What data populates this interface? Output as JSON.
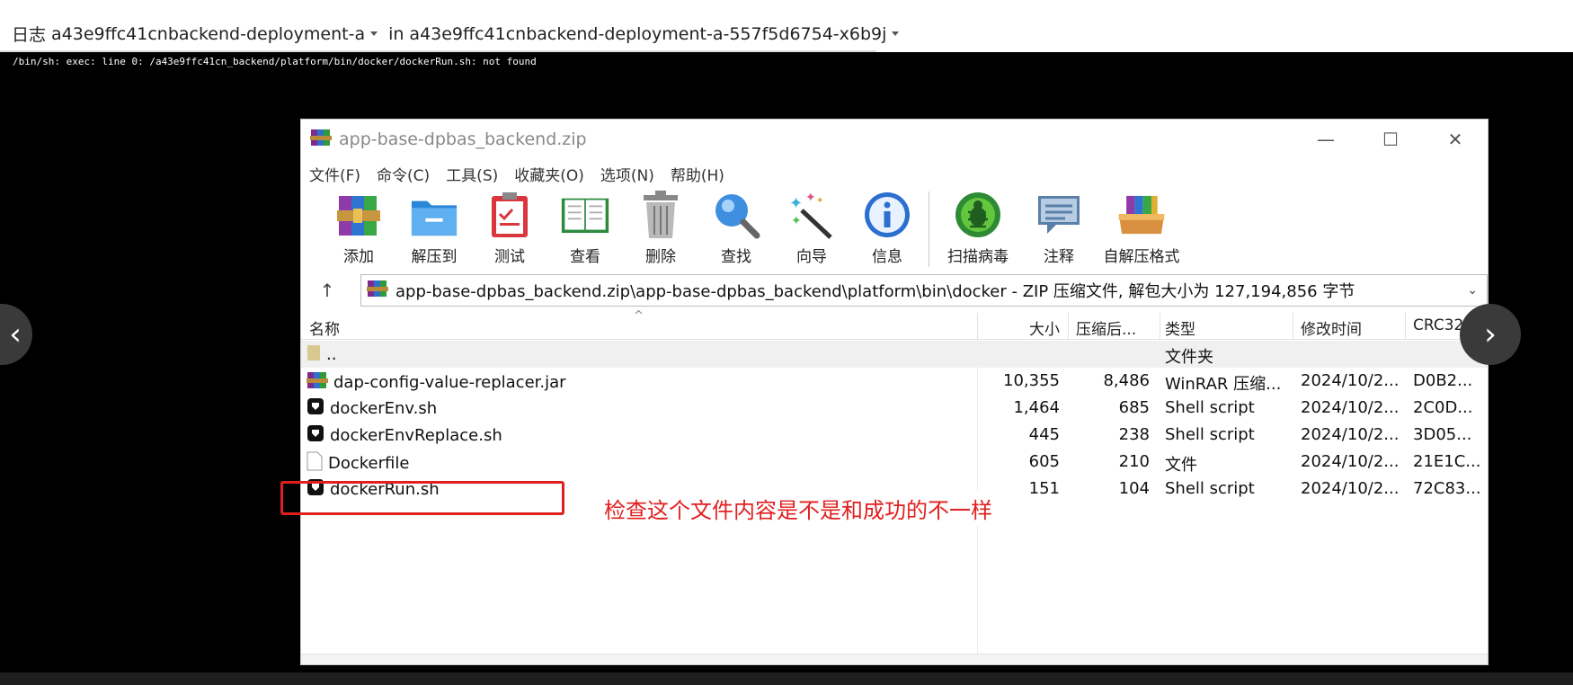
{
  "header": {
    "log_label": "日志",
    "deployment": "a43e9ffc41cnbackend-deployment-a",
    "in_label": "in",
    "pod": "a43e9ffc41cnbackend-deployment-a-557f5d6754-x6b9j"
  },
  "log": {
    "line": "/bin/sh: exec: line 0: /a43e9ffc41cn_backend/platform/bin/docker/dockerRun.sh: not found"
  },
  "window": {
    "title": "app-base-dpbas_backend.zip",
    "controls": {
      "minimize": "—",
      "maximize": "☐",
      "close": "✕"
    },
    "menu": [
      "文件(F)",
      "命令(C)",
      "工具(S)",
      "收藏夹(O)",
      "选项(N)",
      "帮助(H)"
    ],
    "toolbar": [
      {
        "label": "添加",
        "icon": "add-archive-icon"
      },
      {
        "label": "解压到",
        "icon": "extract-folder-icon"
      },
      {
        "label": "测试",
        "icon": "test-clipboard-icon"
      },
      {
        "label": "查看",
        "icon": "view-book-icon"
      },
      {
        "label": "删除",
        "icon": "trash-icon"
      },
      {
        "label": "查找",
        "icon": "magnifier-icon"
      },
      {
        "label": "向导",
        "icon": "wizard-wand-icon"
      },
      {
        "label": "信息",
        "icon": "info-icon"
      },
      {
        "label": "扫描病毒",
        "icon": "virus-scan-icon"
      },
      {
        "label": "注释",
        "icon": "comment-icon"
      },
      {
        "label": "自解压格式",
        "icon": "sfx-icon"
      }
    ],
    "path": "app-base-dpbas_backend.zip\\app-base-dpbas_backend\\platform\\bin\\docker - ZIP 压缩文件, 解包大小为 127,194,856 字节",
    "columns": {
      "name": "名称",
      "size": "大小",
      "packed": "压缩后...",
      "type": "类型",
      "modified": "修改时间",
      "crc": "CRC32"
    },
    "files": [
      {
        "name": "..",
        "size": "",
        "packed": "",
        "type": "文件夹",
        "modified": "",
        "crc": "",
        "icon": "folder-icon"
      },
      {
        "name": "dap-config-value-replacer.jar",
        "size": "10,355",
        "packed": "8,486",
        "type": "WinRAR 压缩...",
        "modified": "2024/10/2...",
        "crc": "D0B2...",
        "icon": "winrar-icon"
      },
      {
        "name": "dockerEnv.sh",
        "size": "1,464",
        "packed": "685",
        "type": "Shell script",
        "modified": "2024/10/2...",
        "crc": "2C0D...",
        "icon": "shell-script-icon"
      },
      {
        "name": "dockerEnvReplace.sh",
        "size": "445",
        "packed": "238",
        "type": "Shell script",
        "modified": "2024/10/2...",
        "crc": "3D05...",
        "icon": "shell-script-icon"
      },
      {
        "name": "Dockerfile",
        "size": "605",
        "packed": "210",
        "type": "文件",
        "modified": "2024/10/2...",
        "crc": "21E1C...",
        "icon": "file-icon"
      },
      {
        "name": "dockerRun.sh",
        "size": "151",
        "packed": "104",
        "type": "Shell script",
        "modified": "2024/10/2...",
        "crc": "72C83...",
        "icon": "shell-script-icon"
      }
    ]
  },
  "annotation": "检查这个文件内容是不是和成功的不一样",
  "nav": {
    "prev": "‹",
    "next": "›"
  }
}
